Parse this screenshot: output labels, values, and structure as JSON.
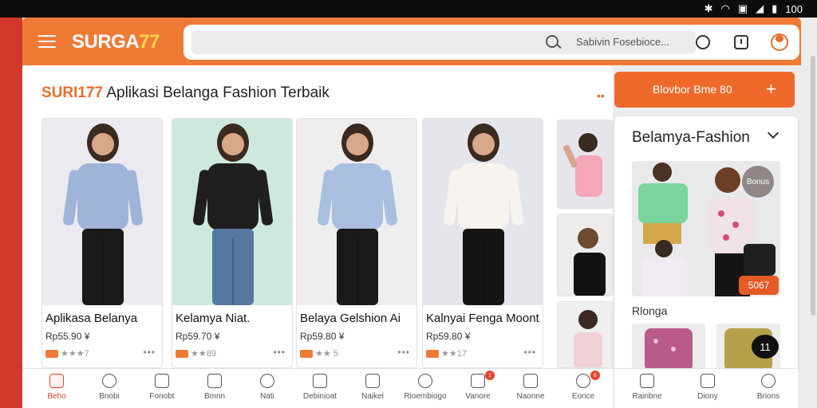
{
  "status": {
    "battery": "100"
  },
  "header": {
    "logo_main": "SURGA",
    "logo_accent": "77",
    "search_placeholder": "",
    "search_hint": "Sabivin Fosebioce..."
  },
  "main": {
    "title_brand": "SURI177",
    "title_text": " Aplikasi Belanga Fashion Terbaik",
    "cards": [
      {
        "name": "Aplikasa Belanya",
        "price": "Rp55.90 ¥",
        "rating": "★★★7",
        "shirt": "#9db4d8",
        "pants": "#1a1a1a",
        "bg": "#eceaf0"
      },
      {
        "name": "Kelamya Niat.",
        "price": "Rp59.70 ¥",
        "rating": "★★89",
        "shirt": "#1f1f1f",
        "pants": "#5577a0",
        "bg": "#cfe8de"
      },
      {
        "name": "Belaya Gelshion Ai",
        "price": "Rp59.80 ¥",
        "rating": "★★ 5",
        "shirt": "#a9bfe0",
        "pants": "#1a1a1a",
        "bg": "#eeeeee"
      },
      {
        "name": "Kalnyai Fenga Moont",
        "price": "Rp59.80 ¥",
        "rating": "★★17",
        "shirt": "#f7f3ee",
        "pants": "#151515",
        "bg": "#e4e6ec"
      }
    ]
  },
  "promo": {
    "label": "Blovbor Bme 80",
    "plus": "+"
  },
  "side": {
    "title": "Belamya-Fashion",
    "badge": "Bonus",
    "price": "5067",
    "subtitle": "Rlonga",
    "count": "11"
  },
  "bottom_nav": [
    {
      "label": "Beho",
      "active": true
    },
    {
      "label": "Bnobi"
    },
    {
      "label": "Fonobt"
    },
    {
      "label": "Bmnn"
    },
    {
      "label": "Nati"
    },
    {
      "label": "Debinioat"
    },
    {
      "label": "Naikel"
    },
    {
      "label": "Rioembiogo"
    },
    {
      "label": "Vanore",
      "badge": "1"
    },
    {
      "label": "Naonne"
    },
    {
      "label": "Eonce",
      "badge": "6"
    }
  ],
  "side_nav": [
    {
      "label": "Rainbne"
    },
    {
      "label": "Diony"
    },
    {
      "label": "Brions"
    }
  ]
}
